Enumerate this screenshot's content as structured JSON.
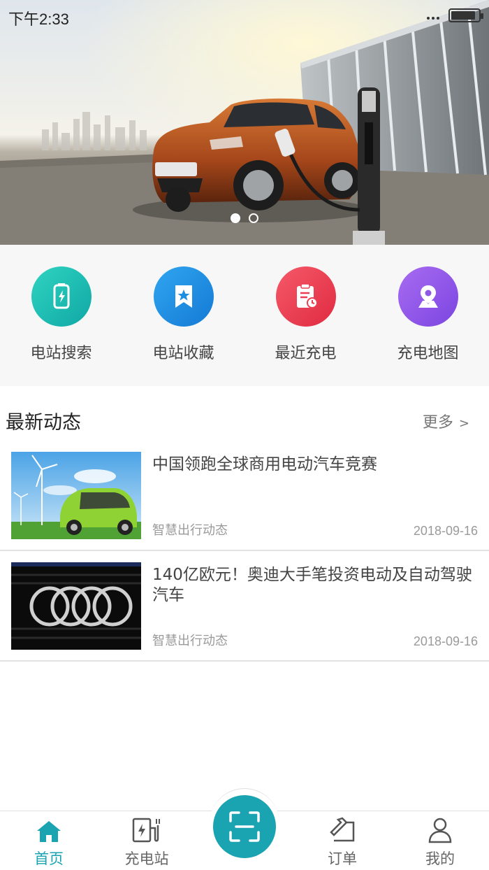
{
  "status_bar": {
    "time": "下午2:33",
    "battery_level": 0.9
  },
  "banner": {
    "slides": 2,
    "active_slide": 0
  },
  "quick_menu": [
    {
      "label": "电站搜索",
      "icon": "charging-station-search-icon",
      "color": "#1dbcb0"
    },
    {
      "label": "电站收藏",
      "icon": "bookmark-star-icon",
      "color": "#1e8fe0"
    },
    {
      "label": "最近充电",
      "icon": "clipboard-clock-icon",
      "color": "#ec3e52"
    },
    {
      "label": "充电地图",
      "icon": "map-pin-icon",
      "color": "#8f59e8"
    }
  ],
  "news": {
    "title": "最新动态",
    "more_label": "更多",
    "more_arrow": ">",
    "items": [
      {
        "title": "中国领跑全球商用电动汽车竞赛",
        "source": "智慧出行动态",
        "date": "2018-09-16",
        "thumb": "green-electric-car-windmills"
      },
      {
        "title": "140亿欧元！奥迪大手笔投资电动及自动驾驶汽车",
        "source": "智慧出行动态",
        "date": "2018-09-16",
        "thumb": "audi-rings-grille"
      }
    ]
  },
  "tabbar": {
    "active_color": "#1aa3b0",
    "items": [
      {
        "label": "首页",
        "icon": "home-icon",
        "active": true
      },
      {
        "label": "充电站",
        "icon": "charger-icon",
        "active": false
      },
      {
        "label": "订单",
        "icon": "order-hammer-icon",
        "active": false
      },
      {
        "label": "我的",
        "icon": "user-icon",
        "active": false
      }
    ],
    "scan_icon": "scan-icon"
  }
}
